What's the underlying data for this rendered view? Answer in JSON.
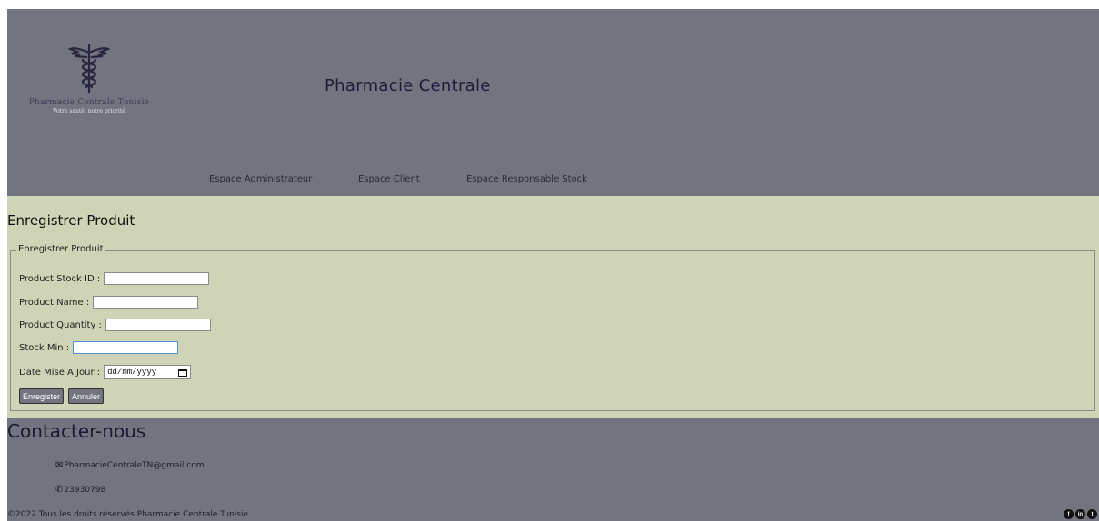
{
  "header": {
    "logo_name": "Pharmacie Centrale Tunisie",
    "logo_tagline": "Votre santé, notre priorité",
    "site_title": "Pharmacie Centrale",
    "nav": [
      {
        "label": "Espace Administrateur"
      },
      {
        "label": "Espace Client"
      },
      {
        "label": "Espace Responsable Stock"
      }
    ]
  },
  "main": {
    "title": "Enregistrer Produit",
    "legend": "Enregistrer Produit",
    "fields": [
      {
        "label": "Product Stock ID :",
        "value": ""
      },
      {
        "label": "Product Name :",
        "value": ""
      },
      {
        "label": "Product Quantity :",
        "value": ""
      },
      {
        "label": "Stock Min :",
        "value": ""
      },
      {
        "label": "Date Mise A Jour :",
        "value": "dd/mm/yyyy"
      }
    ],
    "buttons": {
      "save": "Enregister",
      "cancel": "Annuler"
    }
  },
  "footer": {
    "contact_title": "Contacter-nous",
    "email": "PharmacieCentraleTN@gmail.com",
    "phone": "23930798",
    "copyright": "©2022.Tous les droits réservés Pharmacie Centrale Tunisie",
    "socials": [
      "facebook-icon",
      "linkedin-icon",
      "twitter-icon"
    ]
  },
  "colors": {
    "header_bg": "#72757f",
    "main_bg": "#d0d4b6",
    "title_text": "#201a3a"
  }
}
